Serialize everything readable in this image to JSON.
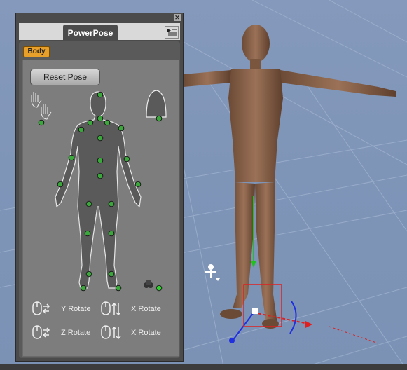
{
  "panel": {
    "tab_label": "PowerPose",
    "body_tab_label": "Body",
    "reset_button_label": "Reset Pose",
    "controls": [
      {
        "label": "Y Rotate"
      },
      {
        "label": "X Rotate"
      },
      {
        "label": "Z Rotate"
      },
      {
        "label": "X Rotate"
      }
    ]
  },
  "icons": {
    "close": "close-icon",
    "panel_menu": "panel-menu-icon",
    "left_hand": "hand-icon",
    "right_hand": "hand-icon",
    "head": "head-icon",
    "figure_nodes_toggle": "group-icon",
    "mouse_horizontal": "mouse-horizontal-drag-icon",
    "mouse_vertical": "mouse-vertical-drag-icon",
    "universal_tool": "figure-tool-icon"
  },
  "colors": {
    "panel_bg": "#4b4b4b",
    "tab_active": "#e8a02b",
    "node_fill": "#3aa83a",
    "viewport_bg": "#8097b8",
    "axis_x": "#e02020",
    "axis_y": "#20c020",
    "axis_z": "#2030e0"
  }
}
